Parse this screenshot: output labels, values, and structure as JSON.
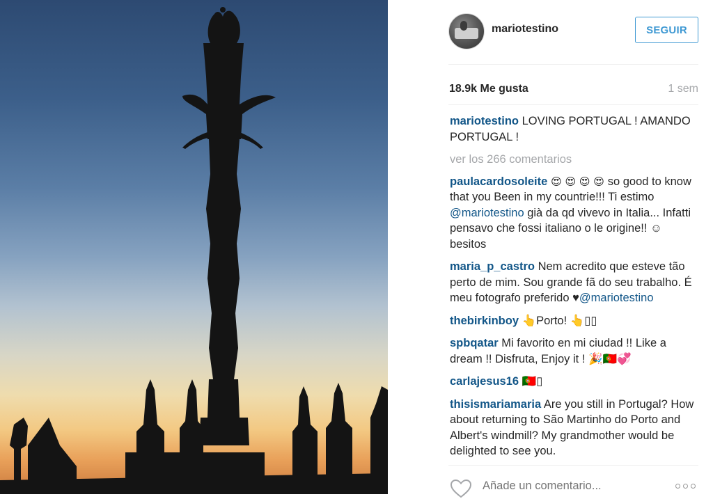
{
  "photo": {
    "alt": "Silhouette of a twisted column pillory against a sunset sky"
  },
  "header": {
    "username": "mariotestino",
    "follow_label": "SEGUIR"
  },
  "stats": {
    "likes": "18.9k Me gusta",
    "time": "1 sem"
  },
  "caption": {
    "user": "mariotestino",
    "text": " LOVING PORTUGAL ! AMANDO PORTUGAL !"
  },
  "view_comments": "ver los 266 comentarios",
  "comments": [
    {
      "user": "paulacardosoleite",
      "emoji": " 😍 😍 😍 😍 ",
      "text1": " so good to know that you Been in my countrie!!! Ti estimo ",
      "mention": "@mariotestino",
      "text2": " già da qd vivevo in Italia... Infatti pensavo che fossi italiano o le origine!! ☺ besitos"
    },
    {
      "user": "maria_p_castro",
      "text1": " Nem acredito que esteve tão perto de mim. Sou grande fã do seu trabalho. É meu fotografo preferido ♥",
      "mention": "@mariotestino"
    },
    {
      "user": "thebirkinboy",
      "text1": " 👆Porto! 👆▯▯"
    },
    {
      "user": "spbqatar",
      "text1": " Mi favorito en mi ciudad !! Like a dream !! Disfruta, Enjoy it ! 🎉🇵🇹💞"
    },
    {
      "user": "carlajesus16",
      "text1": " 🇵🇹▯"
    },
    {
      "user": "thisismariamaria",
      "text1": " Are you still in Portugal? How about returning to São Martinho do Porto and Albert's windmill? My grandmother would be delighted to see you."
    }
  ],
  "footer": {
    "comment_placeholder": "Añade un comentario..."
  },
  "colors": {
    "link": "#125688",
    "follow": "#3f99d3",
    "muted": "#a5a7aa"
  }
}
